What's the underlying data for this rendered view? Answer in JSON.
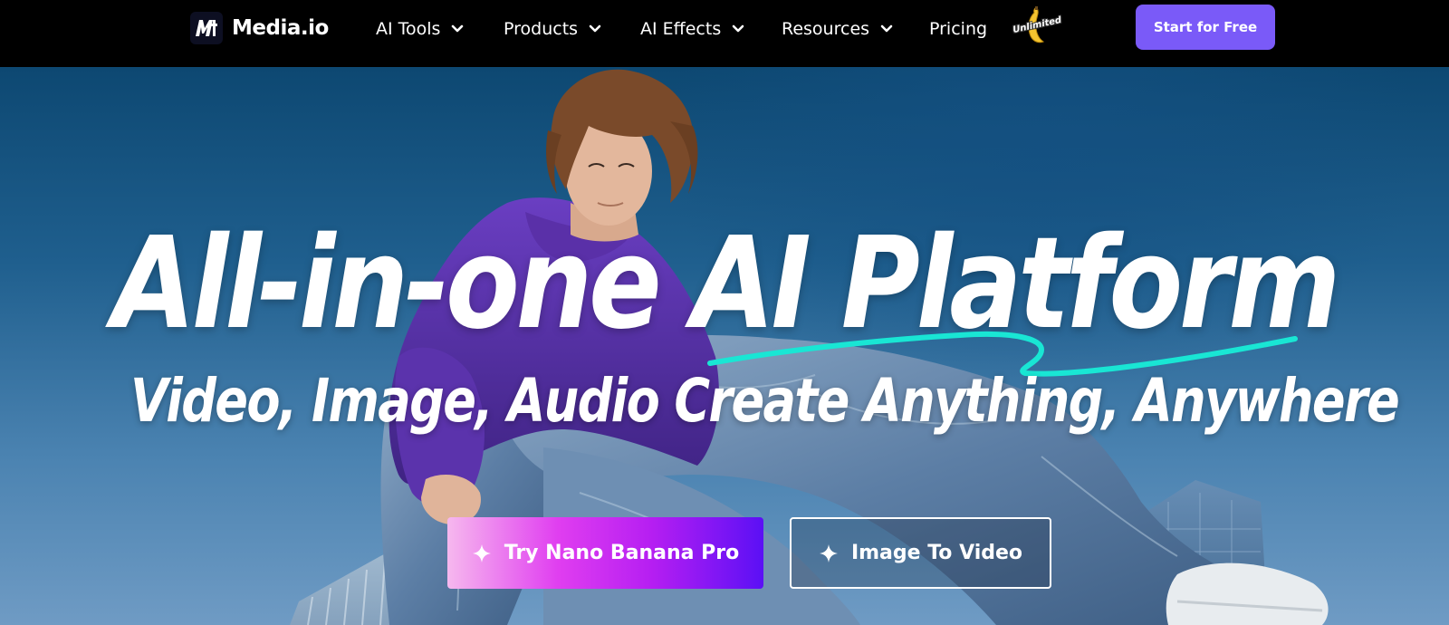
{
  "header": {
    "brand": "Media.io",
    "logo_icon": "media-io-logo-icon",
    "nav": [
      {
        "label": "AI Tools",
        "has_dropdown": true
      },
      {
        "label": "Products",
        "has_dropdown": true
      },
      {
        "label": "AI Effects",
        "has_dropdown": true
      },
      {
        "label": "Resources",
        "has_dropdown": true
      },
      {
        "label": "Pricing",
        "has_dropdown": false
      }
    ],
    "badge": {
      "label": "Unlimited",
      "icon": "banana-icon"
    },
    "cta_label": "Start for Free"
  },
  "hero": {
    "headline": "All-in-one AI Platform",
    "subheadline": "Video, Image, Audio Create Anything, Anywhere",
    "primary_button": {
      "label": "Try Nano Banana Pro",
      "icon": "sparkle-icon"
    },
    "secondary_button": {
      "label": "Image To Video",
      "icon": "sparkle-icon"
    }
  },
  "colors": {
    "nav_background": "#000000",
    "cta_purple": "#7a5af8",
    "swash_cyan": "#19e6d4",
    "primary_gradient_start": "#f6b8ee",
    "primary_gradient_end": "#5b10f5"
  }
}
